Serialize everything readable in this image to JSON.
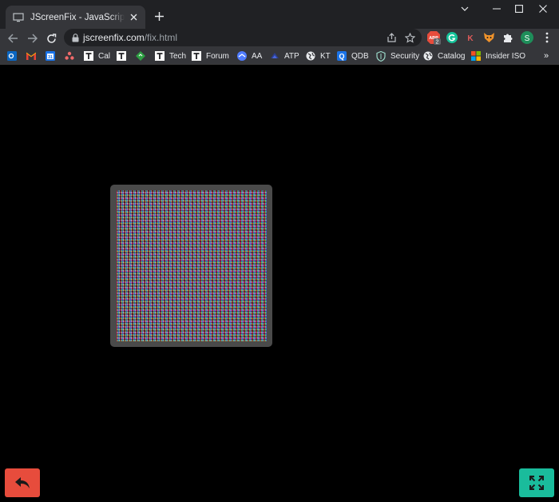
{
  "browser": {
    "tab": {
      "title": "JScreenFix - JavaScript Screen Pixel Fixer"
    },
    "address": {
      "host": "jscreenfix.com",
      "path": "/fix.html"
    },
    "extensions": [
      {
        "name": "adblock-icon",
        "badge": "2",
        "color": "#e74c3c"
      },
      {
        "name": "grammarly-icon",
        "color": "#15c39a"
      },
      {
        "name": "k-extension-icon",
        "letter": "K",
        "color": "#e05a5a"
      },
      {
        "name": "fox-extension-icon",
        "color": "#f0932b"
      },
      {
        "name": "puzzle-icon",
        "color": "#e8eaed"
      }
    ],
    "profile": {
      "initial": "S",
      "color": "#1e8e5a"
    },
    "bookmarks": [
      {
        "name": "outlook",
        "label": "",
        "icon": "outlook-icon",
        "color": "#0a66c2",
        "glyph": "o"
      },
      {
        "name": "gmail",
        "label": "",
        "icon": "gmail-icon",
        "color": "#ea4335",
        "glyph": "M"
      },
      {
        "name": "calendar",
        "label": "",
        "icon": "calendar-icon",
        "color": "#1a73e8",
        "glyph": "31"
      },
      {
        "name": "asana",
        "label": "",
        "icon": "asana-icon",
        "color": "#f06a6a",
        "glyph": "∴"
      },
      {
        "name": "cal",
        "label": "Cal",
        "icon": "t-icon",
        "color": "#ffffff",
        "glyph": "T"
      },
      {
        "name": "t-plain",
        "label": "",
        "icon": "t-icon",
        "color": "#ffffff",
        "glyph": "T"
      },
      {
        "name": "green",
        "label": "",
        "icon": "green-leaf-icon",
        "color": "#2ea043",
        "glyph": "◆"
      },
      {
        "name": "tech",
        "label": "Tech",
        "icon": "t-icon",
        "color": "#ffffff",
        "glyph": "T"
      },
      {
        "name": "forum",
        "label": "Forum",
        "icon": "t-icon",
        "color": "#ffffff",
        "glyph": "T"
      },
      {
        "name": "aa",
        "label": "AA",
        "icon": "aa-icon",
        "color": "#4f7cff",
        "glyph": "◉"
      },
      {
        "name": "atp",
        "label": "ATP",
        "icon": "atp-icon",
        "color": "#2b3f8f",
        "glyph": "◆"
      },
      {
        "name": "kt",
        "label": "KT",
        "icon": "globe-icon",
        "color": "#e8eaed",
        "glyph": "◍"
      },
      {
        "name": "qdb",
        "label": "QDB",
        "icon": "q-icon",
        "color": "#1a73e8",
        "glyph": "Q"
      },
      {
        "name": "security",
        "label": "Security",
        "icon": "shield-icon",
        "color": "#9ad8c8",
        "glyph": "⛉"
      },
      {
        "name": "catalog",
        "label": "Catalog",
        "icon": "globe-icon",
        "color": "#e8eaed",
        "glyph": "◍"
      },
      {
        "name": "insider-iso",
        "label": "Insider ISO",
        "icon": "windows-icon",
        "color": "#f25022",
        "glyph": "⊞"
      }
    ],
    "more_bookmarks": "»"
  },
  "page": {
    "background": "#000000",
    "noise_frame_color": "#4a4a4a",
    "back_button": {
      "icon": "back-arrow-icon",
      "color": "#e74c3c"
    },
    "fullscreen_button": {
      "icon": "fullscreen-icon",
      "color": "#1abc9c"
    }
  }
}
